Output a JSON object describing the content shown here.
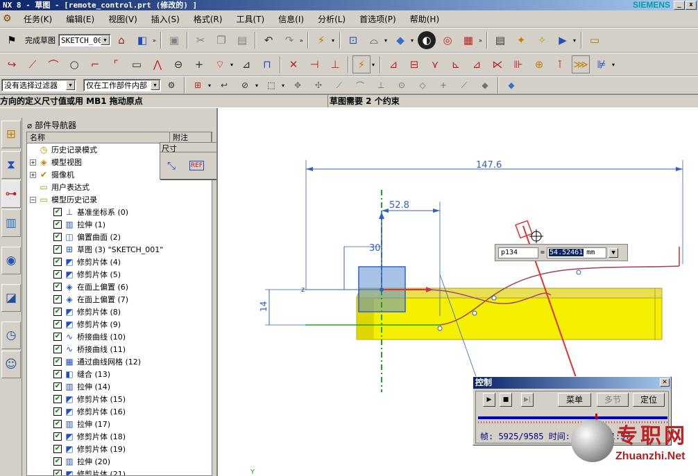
{
  "title": {
    "text": "NX 8 - 草图 - [remote_control.prt (修改的) ]",
    "brand": "SIEMENS"
  },
  "menu": [
    "任务(K)",
    "编辑(E)",
    "视图(V)",
    "插入(S)",
    "格式(R)",
    "工具(T)",
    "信息(I)",
    "分析(L)",
    "首选项(P)",
    "帮助(H)"
  ],
  "toolbar1": {
    "finish_sketch": "完成草图",
    "sketch_name": "SKETCH_005"
  },
  "toolbar3": {
    "filter": "没有选择过滤器",
    "scope": "仅在工作部件内部"
  },
  "status": {
    "left": "方向的定义尺寸值或用 MB1 拖动原点",
    "right": "草图需要 2 个约束"
  },
  "navigator": {
    "title": "部件导航器",
    "col_name": "名称",
    "col_note": "附注",
    "items": [
      {
        "label": "历史记录模式",
        "level": 0,
        "expander": "",
        "icon": "clock-icon",
        "glyph": "◷",
        "check": false
      },
      {
        "label": "模型视图",
        "level": 0,
        "expander": "+",
        "icon": "view-icon",
        "glyph": "◈",
        "check": false
      },
      {
        "label": "摄像机",
        "level": 0,
        "expander": "+",
        "icon": "camera-icon",
        "glyph": "✔",
        "check": false
      },
      {
        "label": "用户表达式",
        "level": 0,
        "expander": "",
        "icon": "folder-icon",
        "glyph": "▭",
        "check": false
      },
      {
        "label": "模型历史记录",
        "level": 0,
        "expander": "−",
        "icon": "folder-open-icon",
        "glyph": "▭",
        "check": false
      },
      {
        "label": "基准坐标系 (0)",
        "level": 1,
        "icon": "datum-csys-icon",
        "glyph": "⊥",
        "check": true
      },
      {
        "label": "拉伸 (1)",
        "level": 1,
        "icon": "extrude-icon",
        "glyph": "▥",
        "check": true
      },
      {
        "label": "偏置曲面 (2)",
        "level": 1,
        "icon": "offset-surface-icon",
        "glyph": "◫",
        "check": true
      },
      {
        "label": "草图 (3) \"SKETCH_001\"",
        "level": 1,
        "icon": "sketch-icon",
        "glyph": "⊞",
        "check": true
      },
      {
        "label": "修剪片体 (4)",
        "level": 1,
        "icon": "trim-sheet-icon",
        "glyph": "◩",
        "check": true
      },
      {
        "label": "修剪片体 (5)",
        "level": 1,
        "icon": "trim-sheet-icon",
        "glyph": "◩",
        "check": true
      },
      {
        "label": "在面上偏置 (6)",
        "level": 1,
        "icon": "offset-in-face-icon",
        "glyph": "◈",
        "check": true
      },
      {
        "label": "在面上偏置 (7)",
        "level": 1,
        "icon": "offset-in-face-icon",
        "glyph": "◈",
        "check": true
      },
      {
        "label": "修剪片体 (8)",
        "level": 1,
        "icon": "trim-sheet-icon",
        "glyph": "◩",
        "check": true
      },
      {
        "label": "修剪片体 (9)",
        "level": 1,
        "icon": "trim-sheet-icon",
        "glyph": "◩",
        "check": true
      },
      {
        "label": "桥接曲线 (10)",
        "level": 1,
        "icon": "bridge-curve-icon",
        "glyph": "∿",
        "check": true
      },
      {
        "label": "桥接曲线 (11)",
        "level": 1,
        "icon": "bridge-curve-icon",
        "glyph": "∿",
        "check": true
      },
      {
        "label": "通过曲线网格 (12)",
        "level": 1,
        "icon": "curve-mesh-icon",
        "glyph": "▦",
        "check": true
      },
      {
        "label": "缝合 (13)",
        "level": 1,
        "icon": "sew-icon",
        "glyph": "◧",
        "check": true
      },
      {
        "label": "拉伸 (14)",
        "level": 1,
        "icon": "extrude-icon",
        "glyph": "▥",
        "check": true
      },
      {
        "label": "修剪片体 (15)",
        "level": 1,
        "icon": "trim-sheet-icon",
        "glyph": "◩",
        "check": true
      },
      {
        "label": "修剪片体 (16)",
        "level": 1,
        "icon": "trim-sheet-icon",
        "glyph": "◩",
        "check": true
      },
      {
        "label": "拉伸 (17)",
        "level": 1,
        "icon": "extrude-icon",
        "glyph": "▥",
        "check": true
      },
      {
        "label": "修剪片体 (18)",
        "level": 1,
        "icon": "trim-sheet-icon",
        "glyph": "◩",
        "check": true
      },
      {
        "label": "修剪片体 (19)",
        "level": 1,
        "icon": "trim-sheet-icon",
        "glyph": "◩",
        "check": true
      },
      {
        "label": "拉伸 (20)",
        "level": 1,
        "icon": "extrude-icon",
        "glyph": "▥",
        "check": true
      },
      {
        "label": "修剪片体 (21)",
        "level": 1,
        "icon": "trim-sheet-icon",
        "glyph": "◩",
        "check": true
      }
    ]
  },
  "dim_popup": {
    "title": "尺寸",
    "ref_label": "REF"
  },
  "sketch": {
    "dim_147": "147.6",
    "dim_52": "52.8",
    "dim_30": "30",
    "dim_14": "14",
    "axis_z": "z",
    "axis_y": "Y"
  },
  "input_box": {
    "name": "p134",
    "equals": "=",
    "value": "54.52461",
    "unit": "mm"
  },
  "control": {
    "title": "控制",
    "menu_label": "菜单",
    "step_label": "多节",
    "locate_label": "定位",
    "slider_fraction": 0.62,
    "frame_text": "帧: 5925/9585 时间: 10:45:31:57"
  },
  "watermark": {
    "cn": "专职网",
    "url": "Zhuanzhi.Net"
  },
  "colors": {
    "title_blue": "#0a246a",
    "part_yellow": "#f5f000",
    "dim_blue": "#3060c0",
    "axis_red": "#e03030",
    "axis_green": "#20a020"
  }
}
